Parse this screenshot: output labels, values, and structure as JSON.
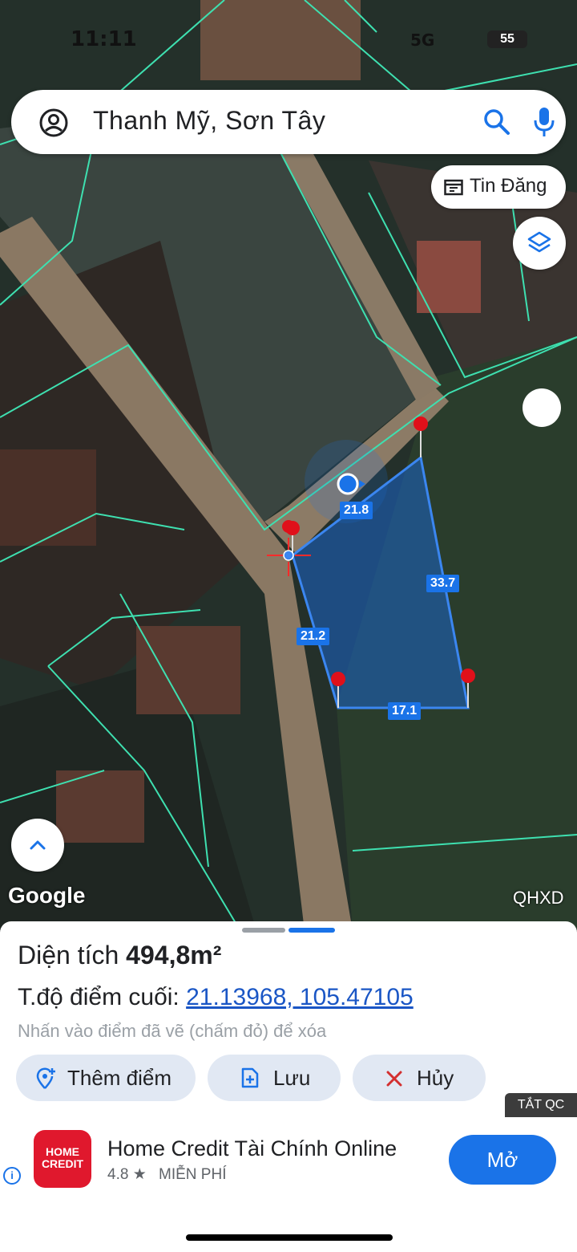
{
  "status": {
    "time": "11:11",
    "network": "5G",
    "battery": "55"
  },
  "search": {
    "query": "Thanh Mỹ, Sơn Tây"
  },
  "map": {
    "tin_dang_label": "Tin Đăng",
    "google_label": "Google",
    "qhxd_label": "QHXD",
    "edge_lengths": [
      "21.8",
      "33.7",
      "17.1",
      "21.2"
    ]
  },
  "sheet": {
    "area_prefix": "Diện tích",
    "area_value": "494,8m²",
    "coords_label": "T.độ điểm cuối:",
    "coords_value": "21.13968, 105.47105",
    "hint": "Nhấn vào điểm đã vẽ (chấm đỏ) để xóa",
    "buttons": {
      "add": "Thêm điểm",
      "save": "Lưu",
      "cancel": "Hủy"
    }
  },
  "ad": {
    "close_label": "TẮT QC",
    "logo_line1": "HOME",
    "logo_line2": "CREDIT",
    "title": "Home Credit Tài Chính Online",
    "rating": "4.8 ★",
    "price": "MIỄN PHÍ",
    "open_label": "Mở",
    "info": "i"
  },
  "colors": {
    "accent": "#1a73e8",
    "marker": "#e0101a",
    "boundary": "#3ee0b0"
  }
}
